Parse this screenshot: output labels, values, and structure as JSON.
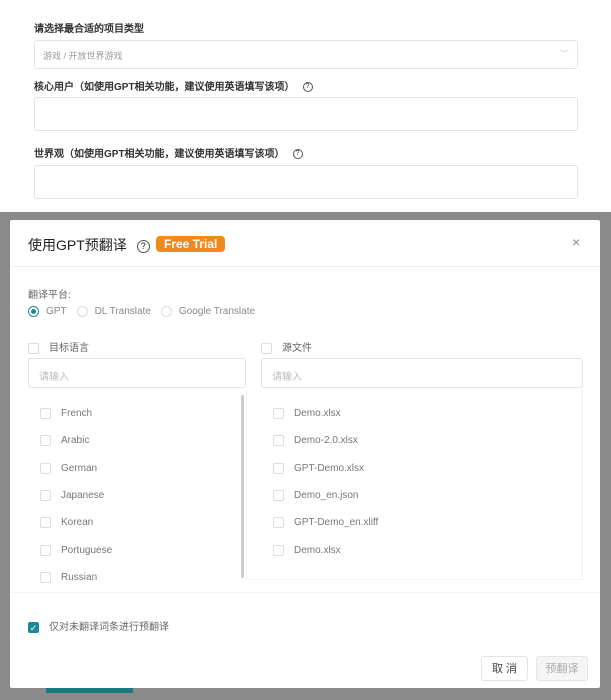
{
  "form": {
    "project_type_label": "请选择最合适的项目类型",
    "project_type_value": "游戏 / 开放世界游戏",
    "core_users_label": "核心用户（如使用GPT相关功能，建议使用英语填写该项）",
    "worldview_label": "世界观（如使用GPT相关功能，建议使用英语填写该项）"
  },
  "modal": {
    "title": "使用GPT预翻译",
    "badge": "Free Trial",
    "close": "×",
    "platform_label": "翻译平台:",
    "platforms": [
      {
        "label": "GPT",
        "selected": true
      },
      {
        "label": "DL Translate",
        "selected": false
      },
      {
        "label": "Google Translate",
        "selected": false
      }
    ],
    "target_lang_label": "目标语言",
    "source_file_label": "源文件",
    "target_placeholder": "请输入",
    "source_placeholder": "请输入",
    "languages": [
      "French",
      "Arabic",
      "German",
      "Japanese",
      "Korean",
      "Portuguese",
      "Russian"
    ],
    "files": [
      "Demo.xlsx",
      "Demo-2.0.xlsx",
      "GPT-Demo.xlsx",
      "Demo_en.json",
      "GPT-Demo_en.xliff",
      "Demo.xlsx"
    ],
    "only_untranslated_label": "仅对未翻译词条进行预翻译",
    "only_untranslated_checked": true,
    "cancel": "取 消",
    "pretranslate": "预翻译"
  },
  "colors": {
    "accent": "#1a8a99",
    "badge": "#f08a1c"
  }
}
